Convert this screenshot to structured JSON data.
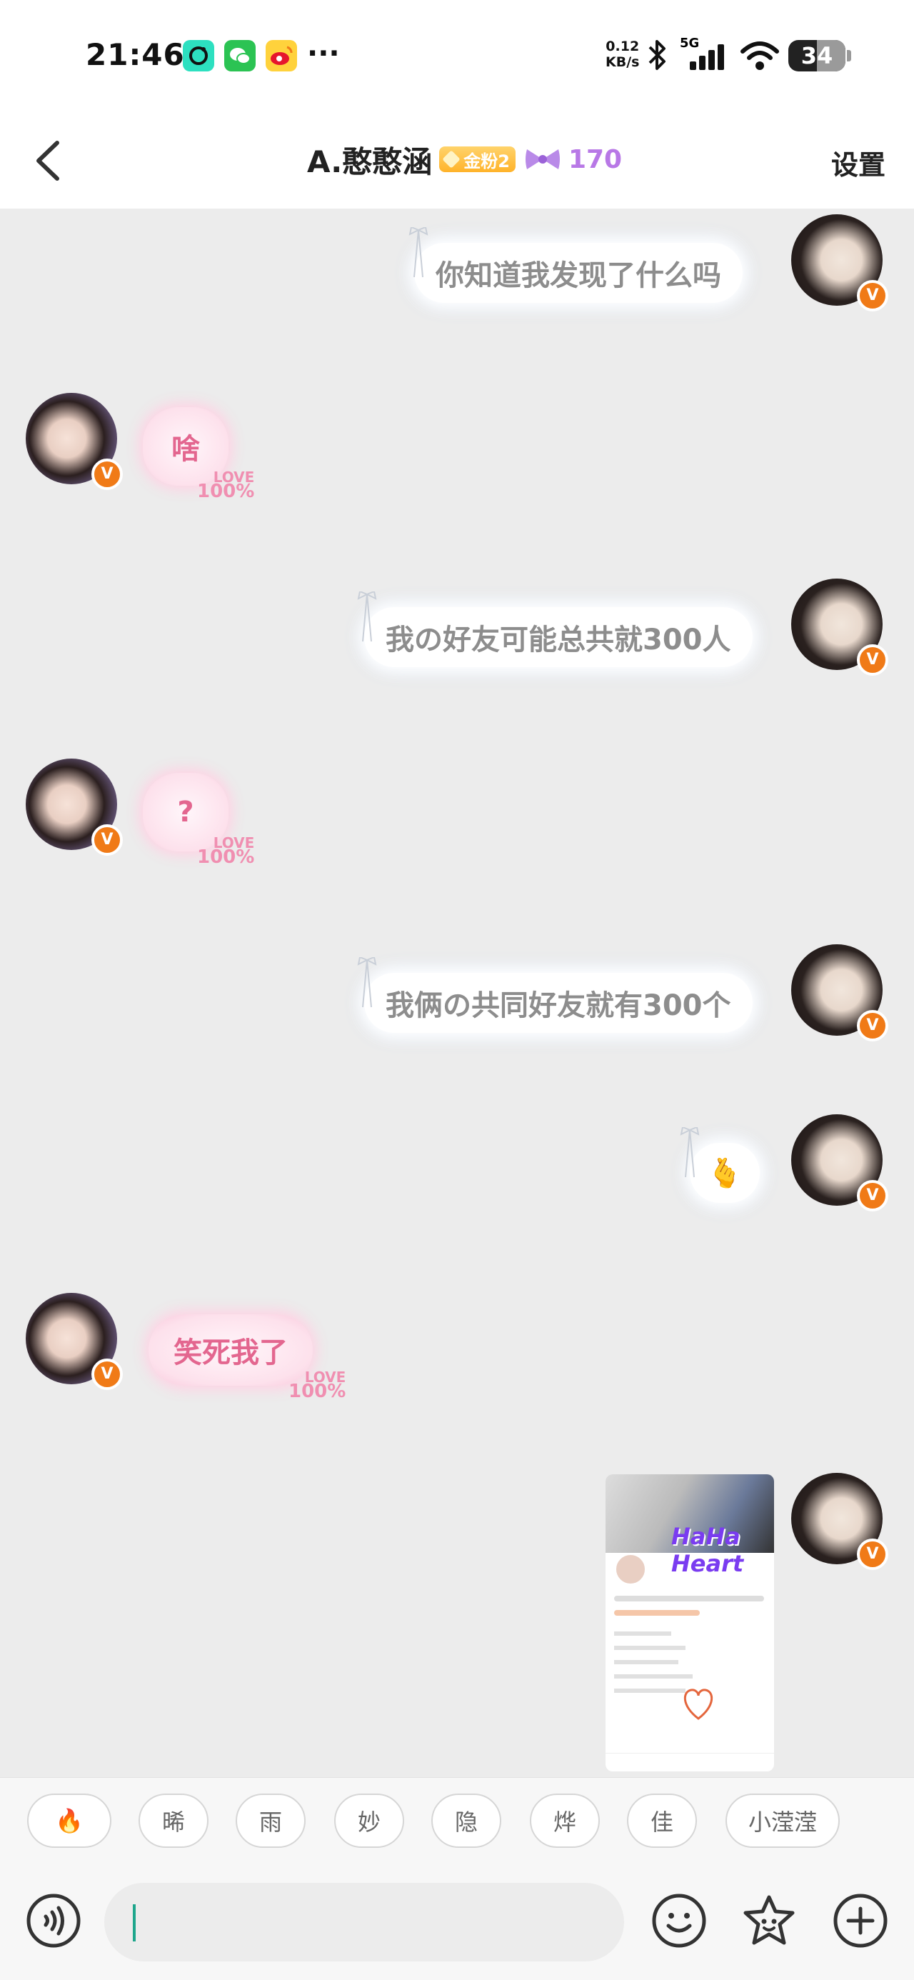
{
  "status_bar": {
    "time": "21:46",
    "more": "···",
    "net_speed_value": "0.12",
    "net_speed_unit": "KB/s",
    "network": "5G",
    "battery": "34",
    "icons": [
      "soul-app-icon",
      "wechat-icon",
      "weibo-icon",
      "bluetooth-icon",
      "signal-icon",
      "wifi-icon",
      "battery-icon"
    ]
  },
  "header": {
    "title": "A.憨憨涵",
    "fan_badge": "金粉2",
    "score": "170",
    "settings": "设置",
    "colors": {
      "score": "#b878e6",
      "badge": "#ffb32a"
    }
  },
  "messages": [
    {
      "side": "right",
      "text": "你知道我发现了什么吗"
    },
    {
      "side": "left",
      "text": "啥",
      "tag_top": "LOVE",
      "tag_bottom": "100%"
    },
    {
      "side": "right",
      "text": "我の好友可能总共就300人"
    },
    {
      "side": "left",
      "text": "?",
      "tag_top": "LOVE",
      "tag_bottom": "100%"
    },
    {
      "side": "right",
      "text": "我俩の共同好友就有300个"
    },
    {
      "side": "right",
      "text": "🫰"
    },
    {
      "side": "left",
      "text": "笑死我了",
      "tag_top": "LOVE",
      "tag_bottom": "100%"
    },
    {
      "side": "right",
      "type": "image",
      "image_text": "HaHa Heart"
    }
  ],
  "quick_chips": [
    "🔥",
    "晞",
    "雨",
    "妙",
    "隐",
    "烨",
    "佳",
    "小滢滢"
  ],
  "input_bar": {
    "placeholder": "",
    "icons": [
      "voice-icon",
      "emoji-icon",
      "sticker-icon",
      "plus-icon"
    ]
  },
  "colors": {
    "accent": "#f07a17",
    "bubble_in_text": "#e3668f",
    "bubble_out_text": "#8d8d8d",
    "chat_bg": "#ececec"
  }
}
